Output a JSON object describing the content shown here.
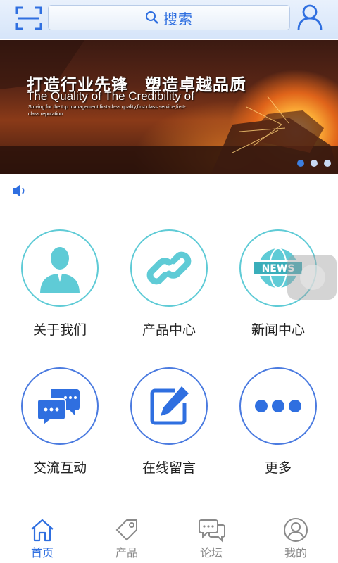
{
  "header": {
    "search_label": "搜索",
    "icons": {
      "scan": "scan-icon",
      "search": "search-icon",
      "user": "user-icon"
    }
  },
  "banner": {
    "headline_cn": "打造行业先锋　塑造卓越品质",
    "headline_en": "The Quality of  The Credibility of",
    "subline_en": "Striving for the top management,first-class quality,first class service,first-class reputation",
    "slide_count": 3,
    "active_slide": 1
  },
  "notice": {
    "icon": "speaker-icon"
  },
  "menu": {
    "items": [
      {
        "label": "关于我们",
        "icon": "person-icon"
      },
      {
        "label": "产品中心",
        "icon": "link-icon"
      },
      {
        "label": "新闻中心",
        "icon": "globe-news-icon",
        "badge": "NEWS"
      },
      {
        "label": "交流互动",
        "icon": "chat-icon"
      },
      {
        "label": "在线留言",
        "icon": "edit-icon"
      },
      {
        "label": "更多",
        "icon": "more-dots-icon"
      }
    ]
  },
  "tabs": [
    {
      "label": "首页",
      "icon": "home-icon",
      "active": true
    },
    {
      "label": "产品",
      "icon": "tag-icon",
      "active": false
    },
    {
      "label": "论坛",
      "icon": "forum-icon",
      "active": false
    },
    {
      "label": "我的",
      "icon": "profile-icon",
      "active": false
    }
  ],
  "colors": {
    "accent": "#2f6fe0",
    "teal": "#5fcbd6",
    "blue_ring": "#4b7be0"
  }
}
